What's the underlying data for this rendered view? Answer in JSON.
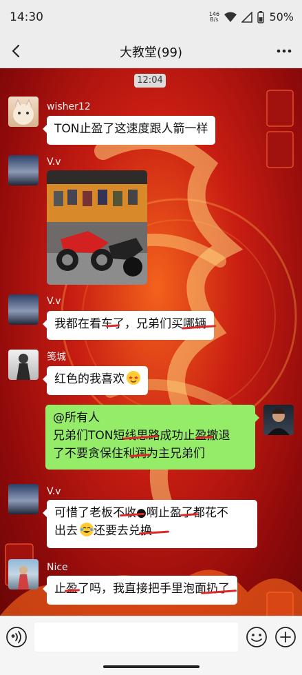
{
  "status": {
    "time": "14:30",
    "net_speed_top": "146",
    "net_speed_bottom": "B/s",
    "battery": "50%"
  },
  "header": {
    "title": "大教堂(99)"
  },
  "chat": {
    "time_chip": "12:04",
    "messages": [
      {
        "sender": "wisher12",
        "text": "TON止盈了这速度跟人箭一样"
      },
      {
        "sender": "V.v",
        "image": "motorcycle-showroom-photo"
      },
      {
        "sender": "V.v",
        "text": "我都在看车了，兄弟们买哪辆"
      },
      {
        "sender": "笺城",
        "text": "红色的我喜欢",
        "emoji": "star-struck-face"
      },
      {
        "mine": true,
        "lines": [
          "@所有人",
          "兄弟们TON短线思路成功止盈撤退",
          "了不要贪保住利润为主兄弟们"
        ]
      },
      {
        "sender": "V.v",
        "line1": "可惜了老板不收●啊止盈了都花不",
        "line2_a": "出去",
        "line2_b": "还要去兑换",
        "emoji": "crying-laughing-face"
      },
      {
        "sender": "Nice",
        "text": "止盈了吗，我直接把手里泡面扔了"
      }
    ]
  },
  "input": {
    "placeholder": ""
  },
  "colors": {
    "bubble_mine": "#95ec69",
    "bubble_other": "#ffffff",
    "chat_bg_red": "#c81d12"
  }
}
